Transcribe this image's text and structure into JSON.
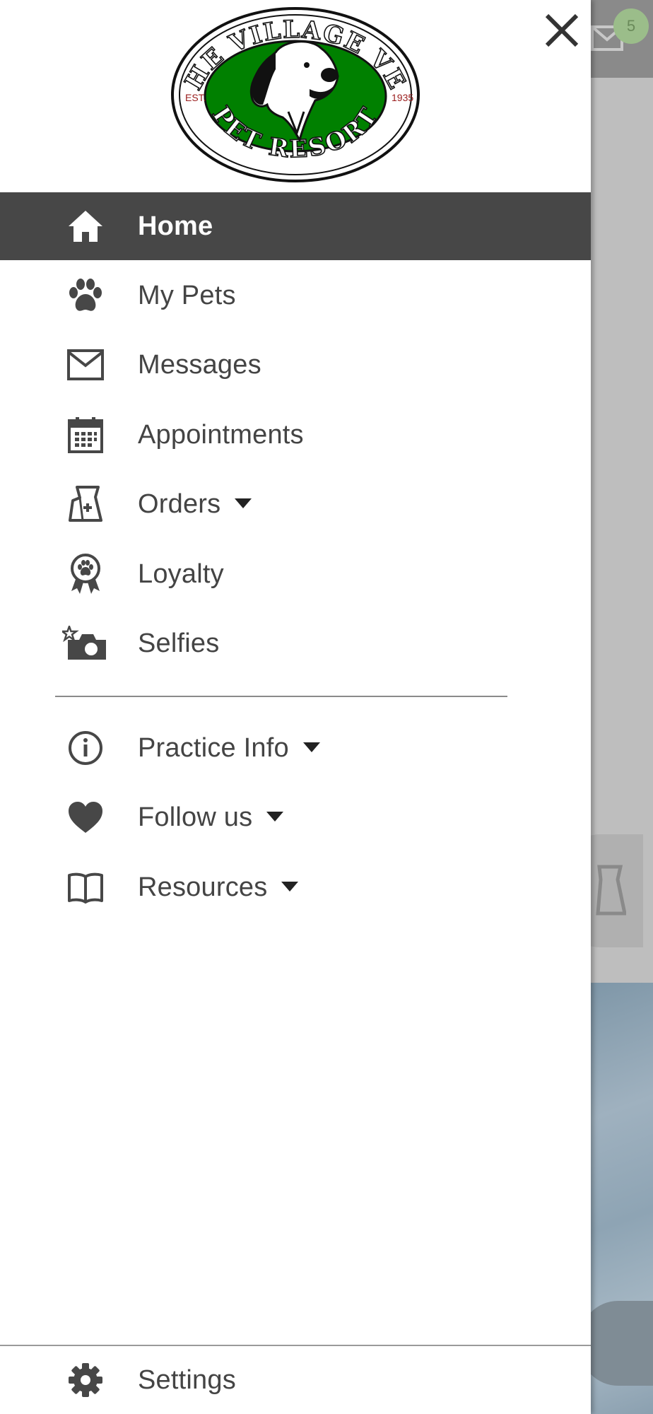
{
  "background": {
    "mail_badge_count": "5"
  },
  "logo": {
    "top_text": "THE VILLAGE VET",
    "bottom_text": "PET RESORT",
    "est_label": "EST.",
    "year": "1935",
    "colors": {
      "green": "#008000",
      "red_text": "#9a1c1c"
    }
  },
  "menu": {
    "items": [
      {
        "label": "Home",
        "icon": "home-icon",
        "active": true
      },
      {
        "label": "My Pets",
        "icon": "paw-icon"
      },
      {
        "label": "Messages",
        "icon": "envelope-icon"
      },
      {
        "label": "Appointments",
        "icon": "calendar-icon"
      },
      {
        "label": "Orders",
        "icon": "food-bag-icon",
        "has_dropdown": true
      },
      {
        "label": "Loyalty",
        "icon": "award-ribbon-icon"
      },
      {
        "label": "Selfies",
        "icon": "camera-star-icon"
      }
    ],
    "secondary_items": [
      {
        "label": "Practice Info",
        "icon": "info-icon",
        "has_dropdown": true
      },
      {
        "label": "Follow us",
        "icon": "heart-icon",
        "has_dropdown": true
      },
      {
        "label": "Resources",
        "icon": "book-icon",
        "has_dropdown": true
      }
    ],
    "settings": {
      "label": "Settings",
      "icon": "gear-icon"
    }
  },
  "colors": {
    "active_bg": "#474747",
    "text": "#444444",
    "icon": "#474747"
  }
}
